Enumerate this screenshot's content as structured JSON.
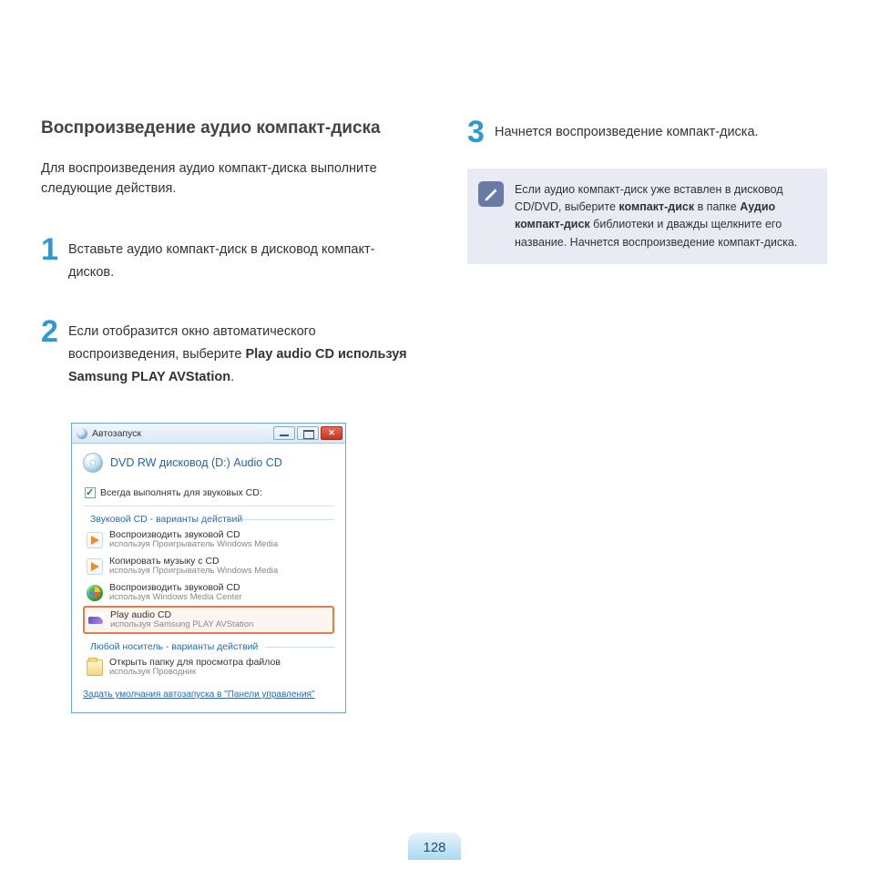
{
  "heading": "Воспроизведение аудио компакт-диска",
  "intro": "Для воспроизведения аудио компакт-диска выполните следующие действия.",
  "steps": {
    "s1": {
      "num": "1",
      "text": "Вставьте аудио компакт-диск в дисковод компакт-дисков."
    },
    "s2": {
      "num": "2",
      "pre": "Если отобразится окно автоматического воспроизведения, выберите ",
      "b1": "Play audio CD используя Samsung PLAY AVStation",
      "post": "."
    },
    "s3": {
      "num": "3",
      "text": "Начнется воспроизведение компакт-диска."
    }
  },
  "autoplay": {
    "title": "Автозапуск",
    "drive": "DVD RW дисковод (D:) Audio CD",
    "checkbox": "Всегда выполнять для звуковых CD:",
    "group1": "Звуковой CD - варианты действий",
    "options": [
      {
        "title": "Воспроизводить звуковой CD",
        "sub": "используя Проигрыватель Windows Media"
      },
      {
        "title": "Копировать музыку с CD",
        "sub": "используя Проигрыватель Windows Media"
      },
      {
        "title": "Воспроизводить звуковой CD",
        "sub": "используя Windows Media Center"
      },
      {
        "title": "Play audio CD",
        "sub": "используя Samsung PLAY AVStation"
      }
    ],
    "group2": "Любой носитель - варианты действий",
    "folder_option": {
      "title": "Открыть папку для просмотра файлов",
      "sub": "используя Проводник"
    },
    "link": "Задать умолчания автозапуска в \"Панели управления\""
  },
  "note": {
    "t1": "Если аудио компакт-диск уже вставлен в дисковод CD/DVD, выберите ",
    "b1": "компакт-диск",
    "t2": " в папке ",
    "b2": "Аудио компакт-диск",
    "t3": " библиотеки и дважды щелкните его название. Начнется воспроизведение компакт-диска."
  },
  "page_number": "128"
}
